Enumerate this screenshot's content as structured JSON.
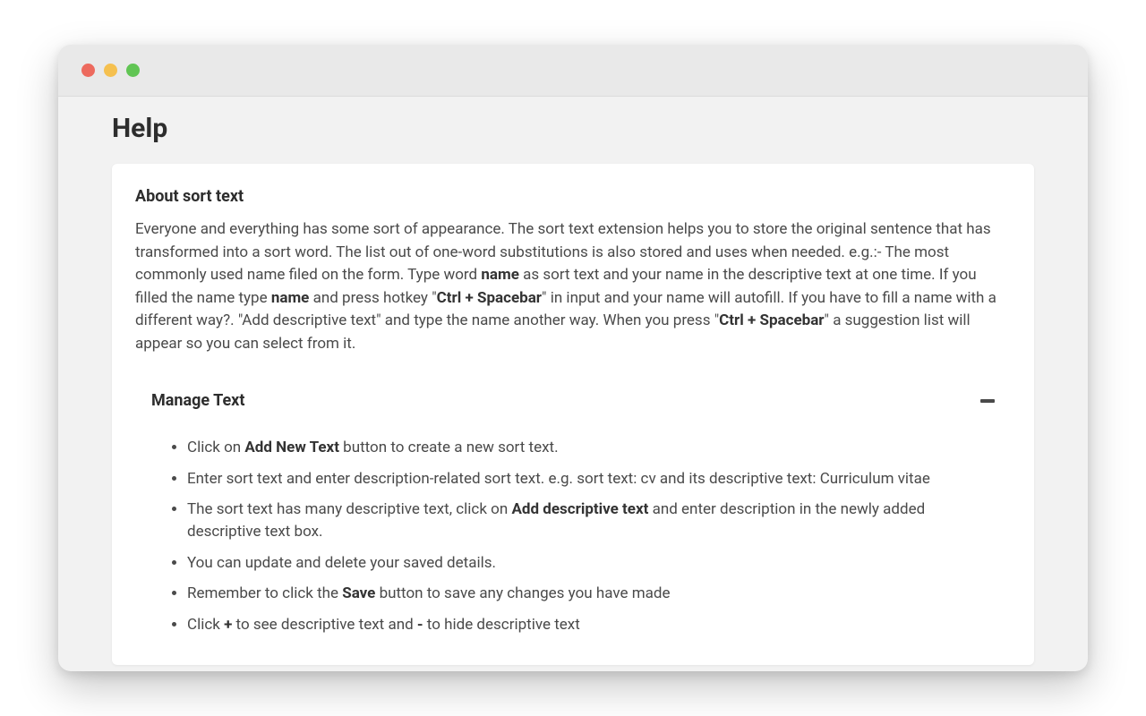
{
  "page": {
    "title": "Help"
  },
  "about": {
    "heading": "About sort text",
    "p1_a": "Everyone and everything has some sort of appearance. The sort text extension helps you to store the original sentence that has transformed into a sort word. The list out of one-word substitutions is also stored and uses when needed. e.g.:- The most commonly used name filed on the form. Type word ",
    "b1": "name",
    "p1_b": " as sort text and your name in the descriptive text at one time. If you filled the name type ",
    "b2": "name",
    "p1_c": " and press hotkey \"",
    "b3": "Ctrl + Spacebar",
    "p1_d": "\" in input and your name will autofill. If you have to fill a name with a different way?. \"Add descriptive text\" and type the name another way. When you press \"",
    "b4": "Ctrl + Spacebar",
    "p1_e": "\" a suggestion list will appear so you can select from it."
  },
  "accordion": {
    "title": "Manage Text",
    "items": [
      {
        "pre": "Click on ",
        "bold": "Add New Text",
        "post": " button to create a new sort text."
      },
      {
        "pre": "Enter sort text and enter description-related sort text. e.g. sort text: cv and its descriptive text: Curriculum vitae",
        "bold": "",
        "post": ""
      },
      {
        "pre": "The sort text has many descriptive text, click on ",
        "bold": "Add descriptive text",
        "post": " and enter description in the newly added descriptive text box."
      },
      {
        "pre": "You can update and delete your saved details.",
        "bold": "",
        "post": ""
      },
      {
        "pre": "Remember to click the ",
        "bold": "Save",
        "post": " button to save any changes you have made"
      },
      {
        "pre": "Click ",
        "bold": "+",
        "mid": " to see descriptive text and ",
        "bold2": "-",
        "post": " to hide descriptive text"
      }
    ]
  }
}
